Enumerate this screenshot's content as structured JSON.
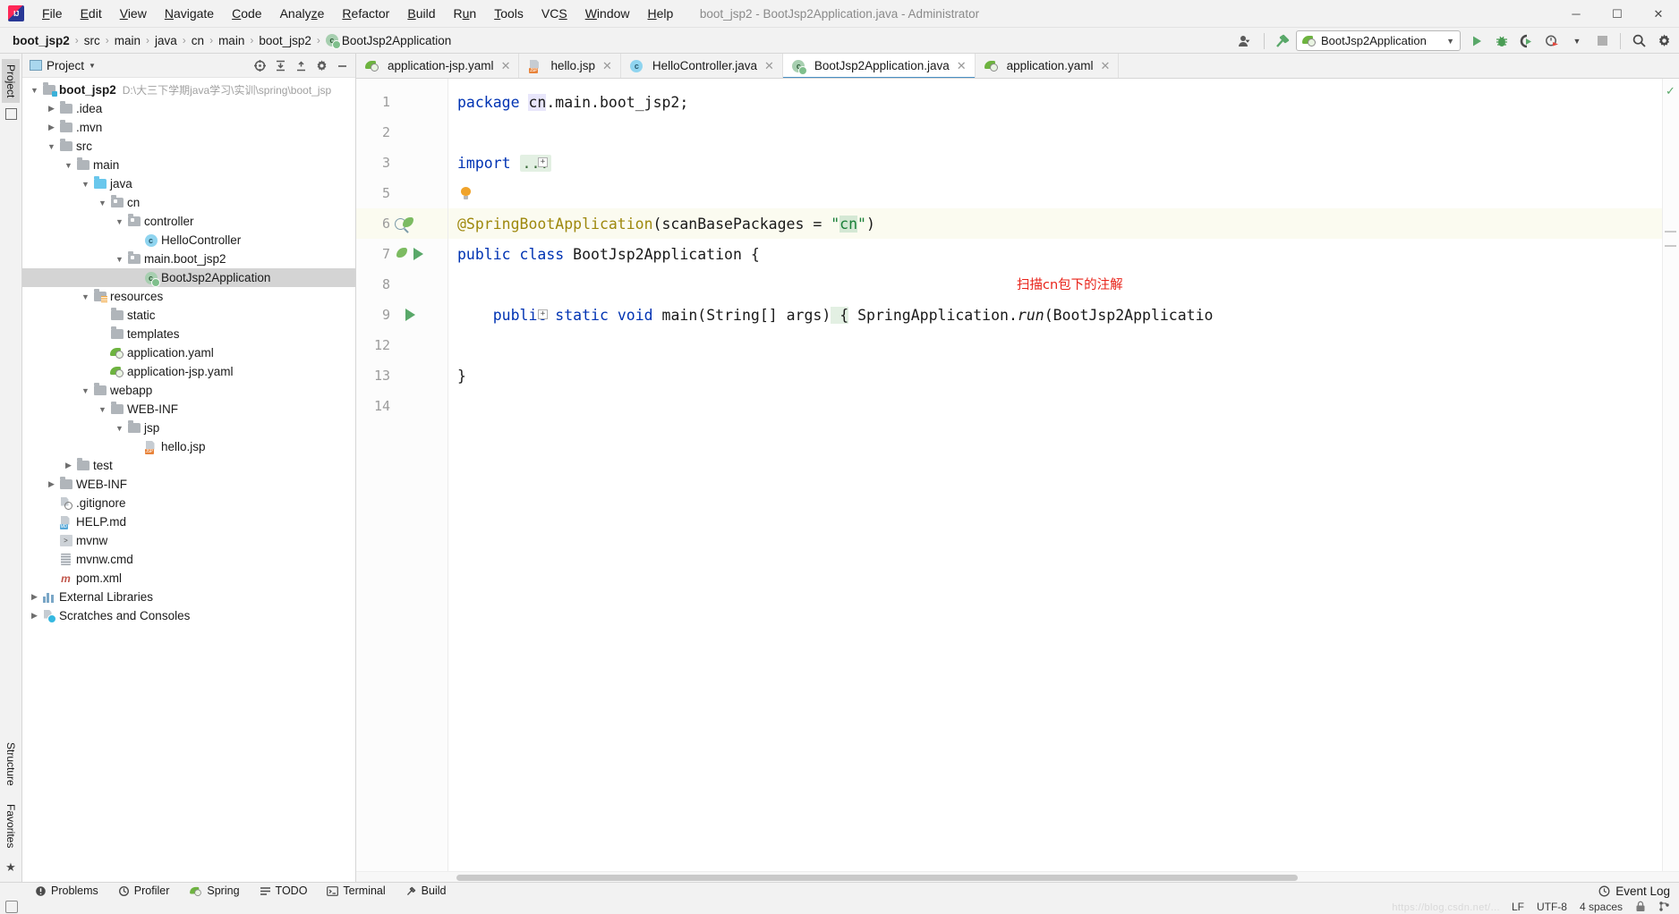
{
  "titlebar": {
    "window_title": "boot_jsp2 - BootJsp2Application.java - Administrator",
    "logo": "intellij-idea-logo",
    "menu": [
      {
        "label": "File",
        "mnemonic": "F"
      },
      {
        "label": "Edit",
        "mnemonic": "E"
      },
      {
        "label": "View",
        "mnemonic": "V"
      },
      {
        "label": "Navigate",
        "mnemonic": "N"
      },
      {
        "label": "Code",
        "mnemonic": "C"
      },
      {
        "label": "Analyze",
        "mnemonic": "z"
      },
      {
        "label": "Refactor",
        "mnemonic": "R"
      },
      {
        "label": "Build",
        "mnemonic": "B"
      },
      {
        "label": "Run",
        "mnemonic": "u"
      },
      {
        "label": "Tools",
        "mnemonic": "T"
      },
      {
        "label": "VCS",
        "mnemonic": "S"
      },
      {
        "label": "Window",
        "mnemonic": "W"
      },
      {
        "label": "Help",
        "mnemonic": "H"
      }
    ],
    "window_controls": {
      "minimize": "—",
      "maximize": "☐",
      "close": "✕"
    }
  },
  "navbar": {
    "breadcrumbs": [
      "boot_jsp2",
      "src",
      "main",
      "java",
      "cn",
      "main",
      "boot_jsp2",
      "BootJsp2Application"
    ],
    "separator": "›",
    "run_configuration": "BootJsp2Application",
    "actions": {
      "run": "run-button",
      "debug": "debug-button",
      "run_coverage": "run-with-coverage-button",
      "profiler": "profiler-button",
      "stop": "stop-button",
      "search_everywhere": "search-everywhere-button",
      "settings": "settings-button",
      "user": "user-account-button",
      "build": "build-project-button"
    }
  },
  "left_rail": {
    "top_tab": "Project",
    "bottom_tabs": [
      "Structure",
      "Favorites"
    ]
  },
  "project_panel": {
    "title": "Project",
    "header_buttons": [
      "locate-button",
      "expand-all-button",
      "collapse-all-button",
      "settings-button",
      "hide-button"
    ],
    "tree": [
      {
        "label": "boot_jsp2",
        "path": "D:\\大三下学期java学习\\实训\\spring\\boot_jsp",
        "depth": 0,
        "twisty": "open",
        "icon": "project-folder",
        "bold": true
      },
      {
        "label": ".idea",
        "depth": 1,
        "twisty": "closed",
        "icon": "folder"
      },
      {
        "label": ".mvn",
        "depth": 1,
        "twisty": "closed",
        "icon": "folder"
      },
      {
        "label": "src",
        "depth": 1,
        "twisty": "open",
        "icon": "folder"
      },
      {
        "label": "main",
        "depth": 2,
        "twisty": "open",
        "icon": "folder"
      },
      {
        "label": "java",
        "depth": 3,
        "twisty": "open",
        "icon": "source-folder"
      },
      {
        "label": "cn",
        "depth": 4,
        "twisty": "open",
        "icon": "package"
      },
      {
        "label": "controller",
        "depth": 5,
        "twisty": "open",
        "icon": "package"
      },
      {
        "label": "HelloController",
        "depth": 6,
        "twisty": "none",
        "icon": "java-class"
      },
      {
        "label": "main.boot_jsp2",
        "depth": 5,
        "twisty": "open",
        "icon": "package"
      },
      {
        "label": "BootJsp2Application",
        "depth": 6,
        "twisty": "none",
        "icon": "spring-boot-class",
        "selected": true
      },
      {
        "label": "resources",
        "depth": 3,
        "twisty": "open",
        "icon": "resources-folder"
      },
      {
        "label": "static",
        "depth": 4,
        "twisty": "none",
        "icon": "folder"
      },
      {
        "label": "templates",
        "depth": 4,
        "twisty": "none",
        "icon": "folder"
      },
      {
        "label": "application.yaml",
        "depth": 4,
        "twisty": "none",
        "icon": "spring-yaml"
      },
      {
        "label": "application-jsp.yaml",
        "depth": 4,
        "twisty": "none",
        "icon": "spring-yaml"
      },
      {
        "label": "webapp",
        "depth": 3,
        "twisty": "open",
        "icon": "folder"
      },
      {
        "label": "WEB-INF",
        "depth": 4,
        "twisty": "open",
        "icon": "folder"
      },
      {
        "label": "jsp",
        "depth": 5,
        "twisty": "open",
        "icon": "folder"
      },
      {
        "label": "hello.jsp",
        "depth": 6,
        "twisty": "none",
        "icon": "jsp-file"
      },
      {
        "label": "test",
        "depth": 2,
        "twisty": "closed",
        "icon": "folder"
      },
      {
        "label": "WEB-INF",
        "depth": 1,
        "twisty": "closed",
        "icon": "folder"
      },
      {
        "label": ".gitignore",
        "depth": 1,
        "twisty": "none",
        "icon": "gitignore-file"
      },
      {
        "label": "HELP.md",
        "depth": 1,
        "twisty": "none",
        "icon": "markdown-file"
      },
      {
        "label": "mvnw",
        "depth": 1,
        "twisty": "none",
        "icon": "shell-file"
      },
      {
        "label": "mvnw.cmd",
        "depth": 1,
        "twisty": "none",
        "icon": "cmd-file"
      },
      {
        "label": "pom.xml",
        "depth": 1,
        "twisty": "none",
        "icon": "maven-file"
      },
      {
        "label": "External Libraries",
        "depth": 0,
        "twisty": "closed",
        "icon": "libraries"
      },
      {
        "label": "Scratches and Consoles",
        "depth": 0,
        "twisty": "closed",
        "icon": "scratches"
      }
    ]
  },
  "editor": {
    "tabs": [
      {
        "label": "application-jsp.yaml",
        "icon": "spring-yaml",
        "active": false
      },
      {
        "label": "hello.jsp",
        "icon": "jsp-file",
        "active": false
      },
      {
        "label": "HelloController.java",
        "icon": "java-class",
        "active": false
      },
      {
        "label": "BootJsp2Application.java",
        "icon": "spring-boot-class",
        "active": true
      },
      {
        "label": "application.yaml",
        "icon": "spring-yaml",
        "active": false
      }
    ],
    "close_glyph": "✕",
    "line_numbers": [
      "1",
      "2",
      "3",
      "5",
      "6",
      "7",
      "8",
      "9",
      "12",
      "13",
      "14"
    ],
    "annotation_note": "扫描cn包下的注解",
    "code_lines": [
      {
        "num": "1",
        "tokens": [
          {
            "t": "package",
            "c": "kw"
          },
          {
            "t": " ",
            "c": "pl"
          },
          {
            "t": "cn",
            "c": "pkg-hl"
          },
          {
            "t": ".main.boot_jsp2;",
            "c": "pl"
          }
        ]
      },
      {
        "num": "2",
        "tokens": []
      },
      {
        "num": "3",
        "tokens": [
          {
            "t": "import",
            "c": "kw"
          },
          {
            "t": " ",
            "c": "pl"
          },
          {
            "t": "...",
            "c": "fold"
          }
        ],
        "fold_marker": "+"
      },
      {
        "num": "5",
        "tokens": [],
        "gutter_icon": "intention-bulb"
      },
      {
        "num": "6",
        "tokens": [
          {
            "t": "@SpringBootApplication",
            "c": "ann"
          },
          {
            "t": "(scanBasePackages = ",
            "c": "pl"
          },
          {
            "t": "\"",
            "c": "str"
          },
          {
            "t": "cn",
            "c": "str-hl"
          },
          {
            "t": "\")",
            "c": "str"
          }
        ],
        "gutter_icon": "spring-bean",
        "highlight": true
      },
      {
        "num": "7",
        "tokens": [
          {
            "t": "public",
            "c": "kw"
          },
          {
            "t": " ",
            "c": "pl"
          },
          {
            "t": "class",
            "c": "kw"
          },
          {
            "t": " BootJsp2Application {",
            "c": "pl"
          }
        ],
        "gutter_icon": "spring-run"
      },
      {
        "num": "8",
        "tokens": []
      },
      {
        "num": "9",
        "tokens": [
          {
            "t": "    ",
            "c": "pl"
          },
          {
            "t": "public",
            "c": "kw"
          },
          {
            "t": " ",
            "c": "pl"
          },
          {
            "t": "static",
            "c": "kw"
          },
          {
            "t": " ",
            "c": "pl"
          },
          {
            "t": "void",
            "c": "kw"
          },
          {
            "t": " ",
            "c": "pl"
          },
          {
            "t": "main",
            "c": "pl"
          },
          {
            "t": "(String[] args) {",
            "c": "pl"
          },
          {
            "t": " SpringApplication.",
            "c": "pl"
          },
          {
            "t": "run",
            "c": "ital"
          },
          {
            "t": "(BootJsp2Applicatio",
            "c": "pl"
          }
        ],
        "gutter_icon": "run-method",
        "fold_marker": "+"
      },
      {
        "num": "12",
        "tokens": []
      },
      {
        "num": "13",
        "tokens": [
          {
            "t": "}",
            "c": "pl"
          }
        ]
      },
      {
        "num": "14",
        "tokens": []
      }
    ]
  },
  "tool_windows": {
    "items": [
      {
        "label": "Problems",
        "icon": "problems-icon"
      },
      {
        "label": "Profiler",
        "icon": "profiler-icon"
      },
      {
        "label": "Spring",
        "icon": "spring-icon"
      },
      {
        "label": "TODO",
        "icon": "todo-icon"
      },
      {
        "label": "Terminal",
        "icon": "terminal-icon"
      },
      {
        "label": "Build",
        "icon": "build-icon"
      }
    ],
    "event_log": "Event Log"
  },
  "statusbar": {
    "line_separator": "LF",
    "encoding": "UTF-8",
    "indent": "4 spaces",
    "watermark": "https://blog.csdn.net/...",
    "lock_icon": "read-only-toggle",
    "git_icon": "branch-icon"
  },
  "colors": {
    "accent_blue": "#4a90c4",
    "spring_green": "#6db33f",
    "keyword_blue": "#0033b3",
    "annotation_gold": "#9e880d",
    "string_green": "#1a7f37",
    "note_red": "#e8231a",
    "selection_gray": "#d4d4d4",
    "chrome_gray": "#f2f2f2"
  }
}
